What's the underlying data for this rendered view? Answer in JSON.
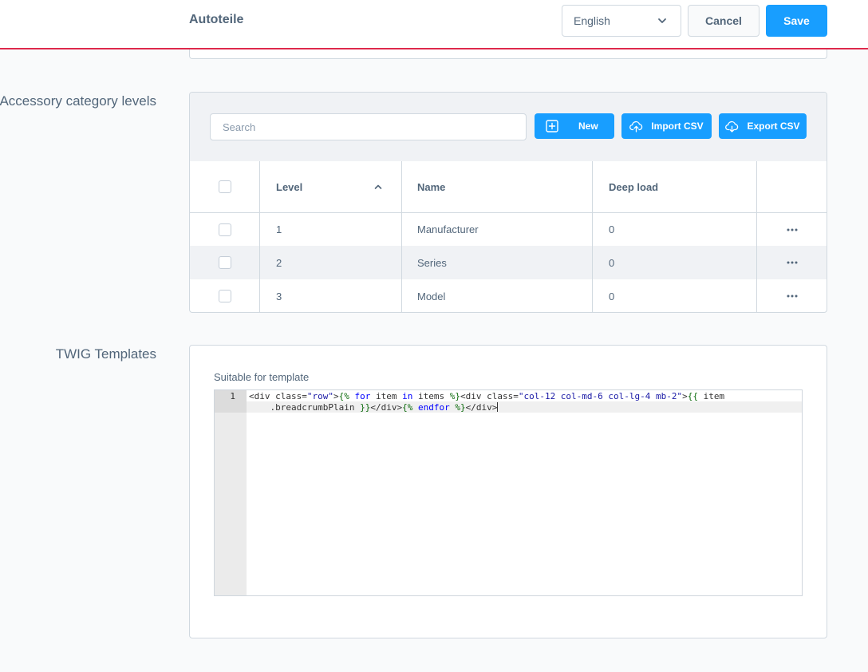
{
  "header": {
    "title": "Autoteile",
    "language": {
      "selected": "English",
      "icon": "chevron-down-icon"
    },
    "cancel_label": "Cancel",
    "save_label": "Save"
  },
  "accessory": {
    "section_label": "Accessory category levels",
    "search": {
      "placeholder": "Search",
      "value": ""
    },
    "toolbar": {
      "new_label": "New",
      "import_label": "Import CSV",
      "export_label": "Export CSV"
    },
    "columns": {
      "level": "Level",
      "name": "Name",
      "deep_load": "Deep load"
    },
    "sort": {
      "column": "Level",
      "direction": "ascending"
    },
    "rows": [
      {
        "level": "1",
        "name": "Manufacturer",
        "deep_load": "0"
      },
      {
        "level": "2",
        "name": "Series",
        "deep_load": "0"
      },
      {
        "level": "3",
        "name": "Model",
        "deep_load": "0"
      }
    ],
    "row_action_icon": "more-horizontal-icon"
  },
  "twig": {
    "section_label": "TWIG Templates",
    "field_label": "Suitable for template",
    "editor": {
      "line_number": "1",
      "code": "<div class=\"row\">{% for item in items %}<div class=\"col-12 col-md-6 col-lg-4 mb-2\">{{ item.breadcrumbPlain }}</div>{% endfor %}</div>"
    }
  },
  "colors": {
    "accent": "#189eff",
    "header_border": "#de294c",
    "text": "#52667a",
    "border": "#d1d9e0"
  }
}
